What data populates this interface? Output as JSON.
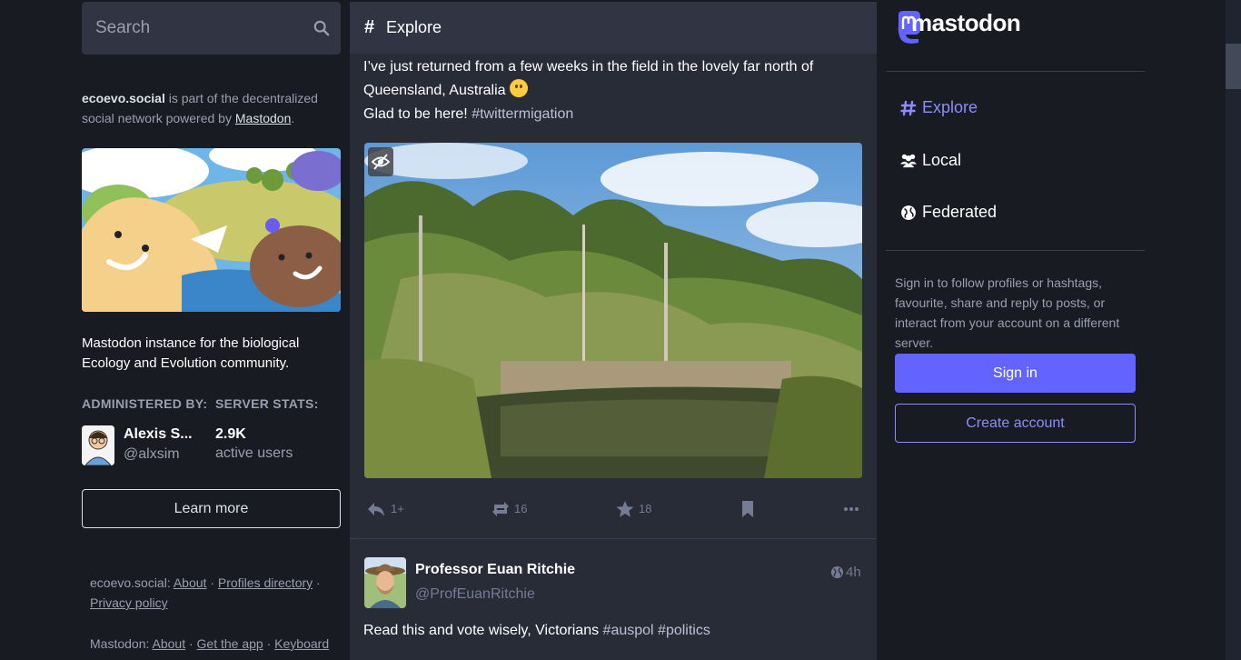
{
  "search": {
    "placeholder": "Search",
    "icon": "search-icon"
  },
  "about": {
    "server": "ecoevo.social",
    "text_mid": " is part of the decentralized social network powered by ",
    "link": "Mastodon",
    "text_end": "."
  },
  "description": "Mastodon instance for the biological Ecology and Evolution community.",
  "admin": {
    "heading": "ADMINISTERED BY:",
    "name": "Alexis S...",
    "handle": "@alxsim"
  },
  "stats": {
    "heading": "SERVER STATS:",
    "count": "2.9K",
    "label": "active users"
  },
  "learn_more": "Learn more",
  "footer": {
    "server_label": "ecoevo.social",
    "about": "About",
    "profiles": "Profiles directory",
    "privacy": "Privacy policy",
    "mastodon_label": "Mastodon",
    "m_about": "About",
    "get_app": "Get the app",
    "keyboard": "Keyboard",
    "sep": " · ",
    "colon": ": "
  },
  "column": {
    "icon": "#",
    "title": "Explore"
  },
  "post1": {
    "line1": "I’ve just returned from a few weeks in the field in the lovely far north of",
    "line2": "Queensland, Australia ",
    "line3": "Glad to be here! ",
    "tag": "#twittermigation",
    "replies": "1+",
    "boosts": "16",
    "favs": "18"
  },
  "post2": {
    "name": "Professor Euan Ritchie",
    "handle": "@ProfEuanRitchie",
    "time": "4h",
    "text": "Read this and vote wisely, Victorians ",
    "tag1": "#auspol",
    "tag2": "#politics"
  },
  "brand": {
    "name": "mastodon"
  },
  "nav": [
    {
      "label": "Explore",
      "icon": "hashtag-icon",
      "color": "#8c8dff"
    },
    {
      "label": "Local",
      "icon": "users-icon",
      "color": "#ffffff"
    },
    {
      "label": "Federated",
      "icon": "globe-icon",
      "color": "#ffffff"
    }
  ],
  "signin_prompt": "Sign in to follow profiles or hashtags, favourite, share and reply to posts, or interact from your account on a different server.",
  "sign_in": "Sign in",
  "create_account": "Create account",
  "colors": {
    "accent": "#6364ff",
    "accent_light": "#8c8dff",
    "bg": "#191b22",
    "panel": "#282c37"
  }
}
